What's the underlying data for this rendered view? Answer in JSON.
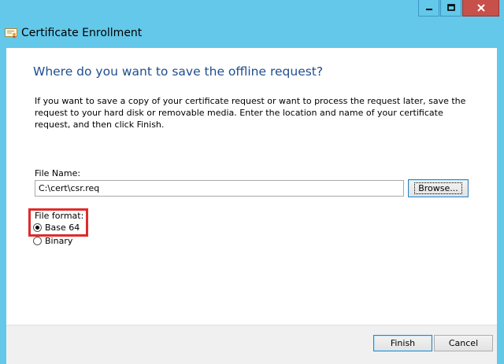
{
  "window": {
    "title": "Certificate Enrollment",
    "icon": "certificate-icon",
    "caption_buttons": [
      "minimize-icon",
      "maximize-icon",
      "close-icon"
    ]
  },
  "page": {
    "heading": "Where do you want to save the offline request?",
    "description": "If you want to save a copy of your certificate request or want to process the request later, save the request to your hard disk or removable media. Enter the location and name of your certificate request, and then click Finish."
  },
  "file_name": {
    "label": "File Name:",
    "value": "C:\\cert\\csr.req",
    "browse_label": "Browse..."
  },
  "file_format": {
    "label": "File format:",
    "options": [
      {
        "label": "Base 64",
        "selected": true
      },
      {
        "label": "Binary",
        "selected": false
      }
    ]
  },
  "footer": {
    "finish_label": "Finish",
    "cancel_label": "Cancel"
  },
  "colors": {
    "frame": "#63c8ea",
    "heading": "#1e4e8f",
    "highlight": "#e02b2b",
    "close_button": "#c7504b"
  }
}
